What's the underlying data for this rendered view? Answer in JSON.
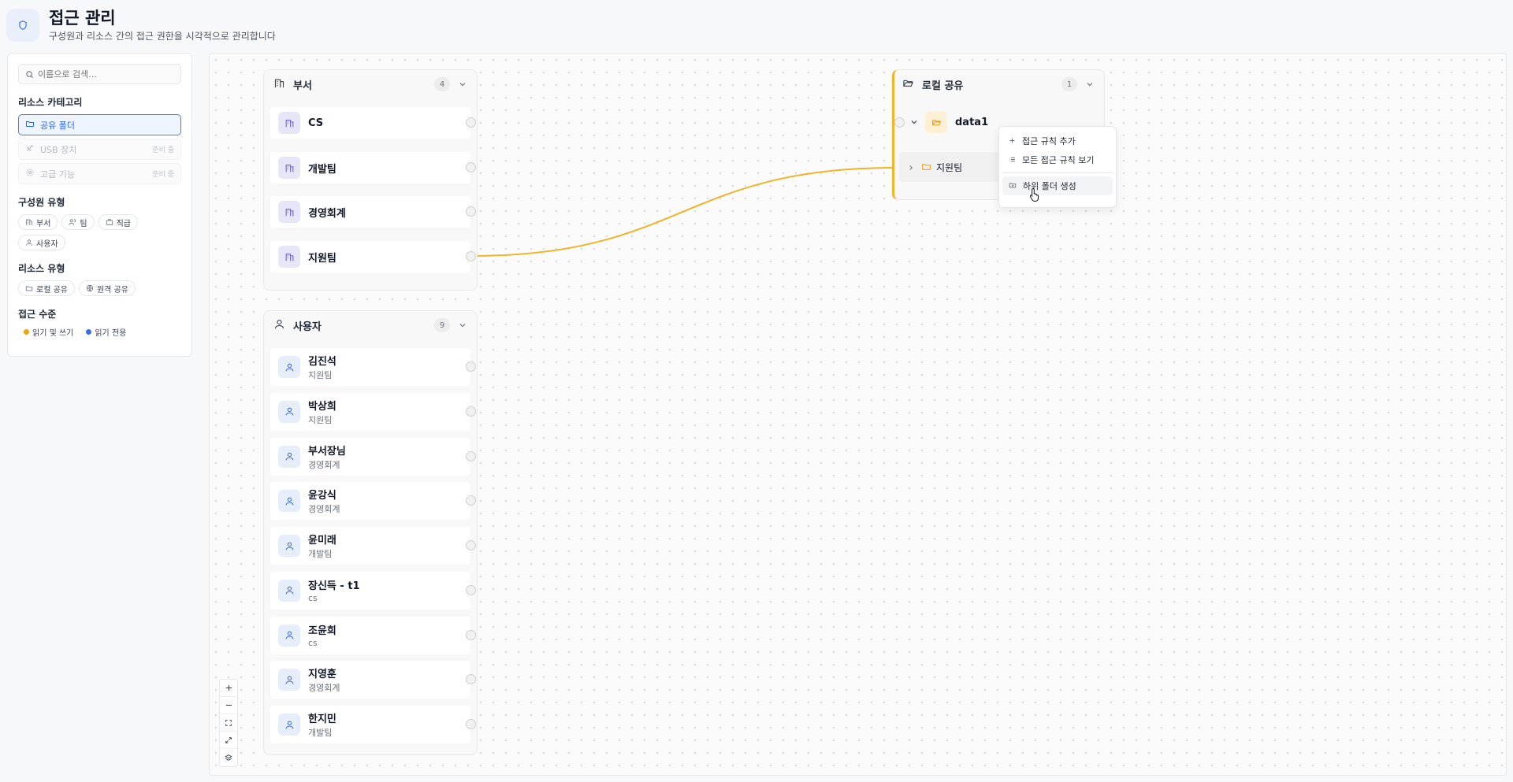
{
  "header": {
    "title": "접근 관리",
    "subtitle": "구성원과 리소스 간의 접근 권한을 시각적으로 관리합니다"
  },
  "sidebar": {
    "search_placeholder": "이름으로 검색...",
    "categories_title": "리소스 카테고리",
    "categories": [
      {
        "label": "공유 폴더",
        "active": true
      },
      {
        "label": "USB 장치",
        "soon": "준비 중"
      },
      {
        "label": "고급 기능",
        "soon": "준비 중"
      }
    ],
    "member_types_title": "구성원 유형",
    "member_types": [
      "부서",
      "팀",
      "직급",
      "사용자"
    ],
    "resource_types_title": "리소스 유형",
    "resource_types": [
      "로컬 공유",
      "원격 공유"
    ],
    "access_levels_title": "접근 수준",
    "access_levels": [
      {
        "label": "읽기 및 쓰기",
        "color": "#f0a21c"
      },
      {
        "label": "읽기 전용",
        "color": "#3b6fe0"
      }
    ]
  },
  "departments": {
    "title": "부서",
    "count": "4",
    "items": [
      "CS",
      "개발팀",
      "경영회계",
      "지원팀"
    ]
  },
  "users": {
    "title": "사용자",
    "count": "9",
    "items": [
      {
        "name": "김진석",
        "dept": "지원팀"
      },
      {
        "name": "박상희",
        "dept": "지원팀"
      },
      {
        "name": "부서장님",
        "dept": "경영회계"
      },
      {
        "name": "윤강식",
        "dept": "경영회계"
      },
      {
        "name": "윤미래",
        "dept": "개발팀"
      },
      {
        "name": "장신득 - t1",
        "dept": "cs"
      },
      {
        "name": "조윤희",
        "dept": "cs"
      },
      {
        "name": "지영훈",
        "dept": "경영회계"
      },
      {
        "name": "한지민",
        "dept": "개발팀"
      }
    ]
  },
  "local_share": {
    "title": "로컬 공유",
    "count": "1",
    "root": "data1",
    "child": "지원팀"
  },
  "context_menu": {
    "items": [
      "접근 규칙 추가",
      "모든 접근 규칙 보기",
      "하위 폴더 생성"
    ]
  },
  "colors": {
    "accent": "#3b82f6",
    "edge": "#f0b429"
  }
}
